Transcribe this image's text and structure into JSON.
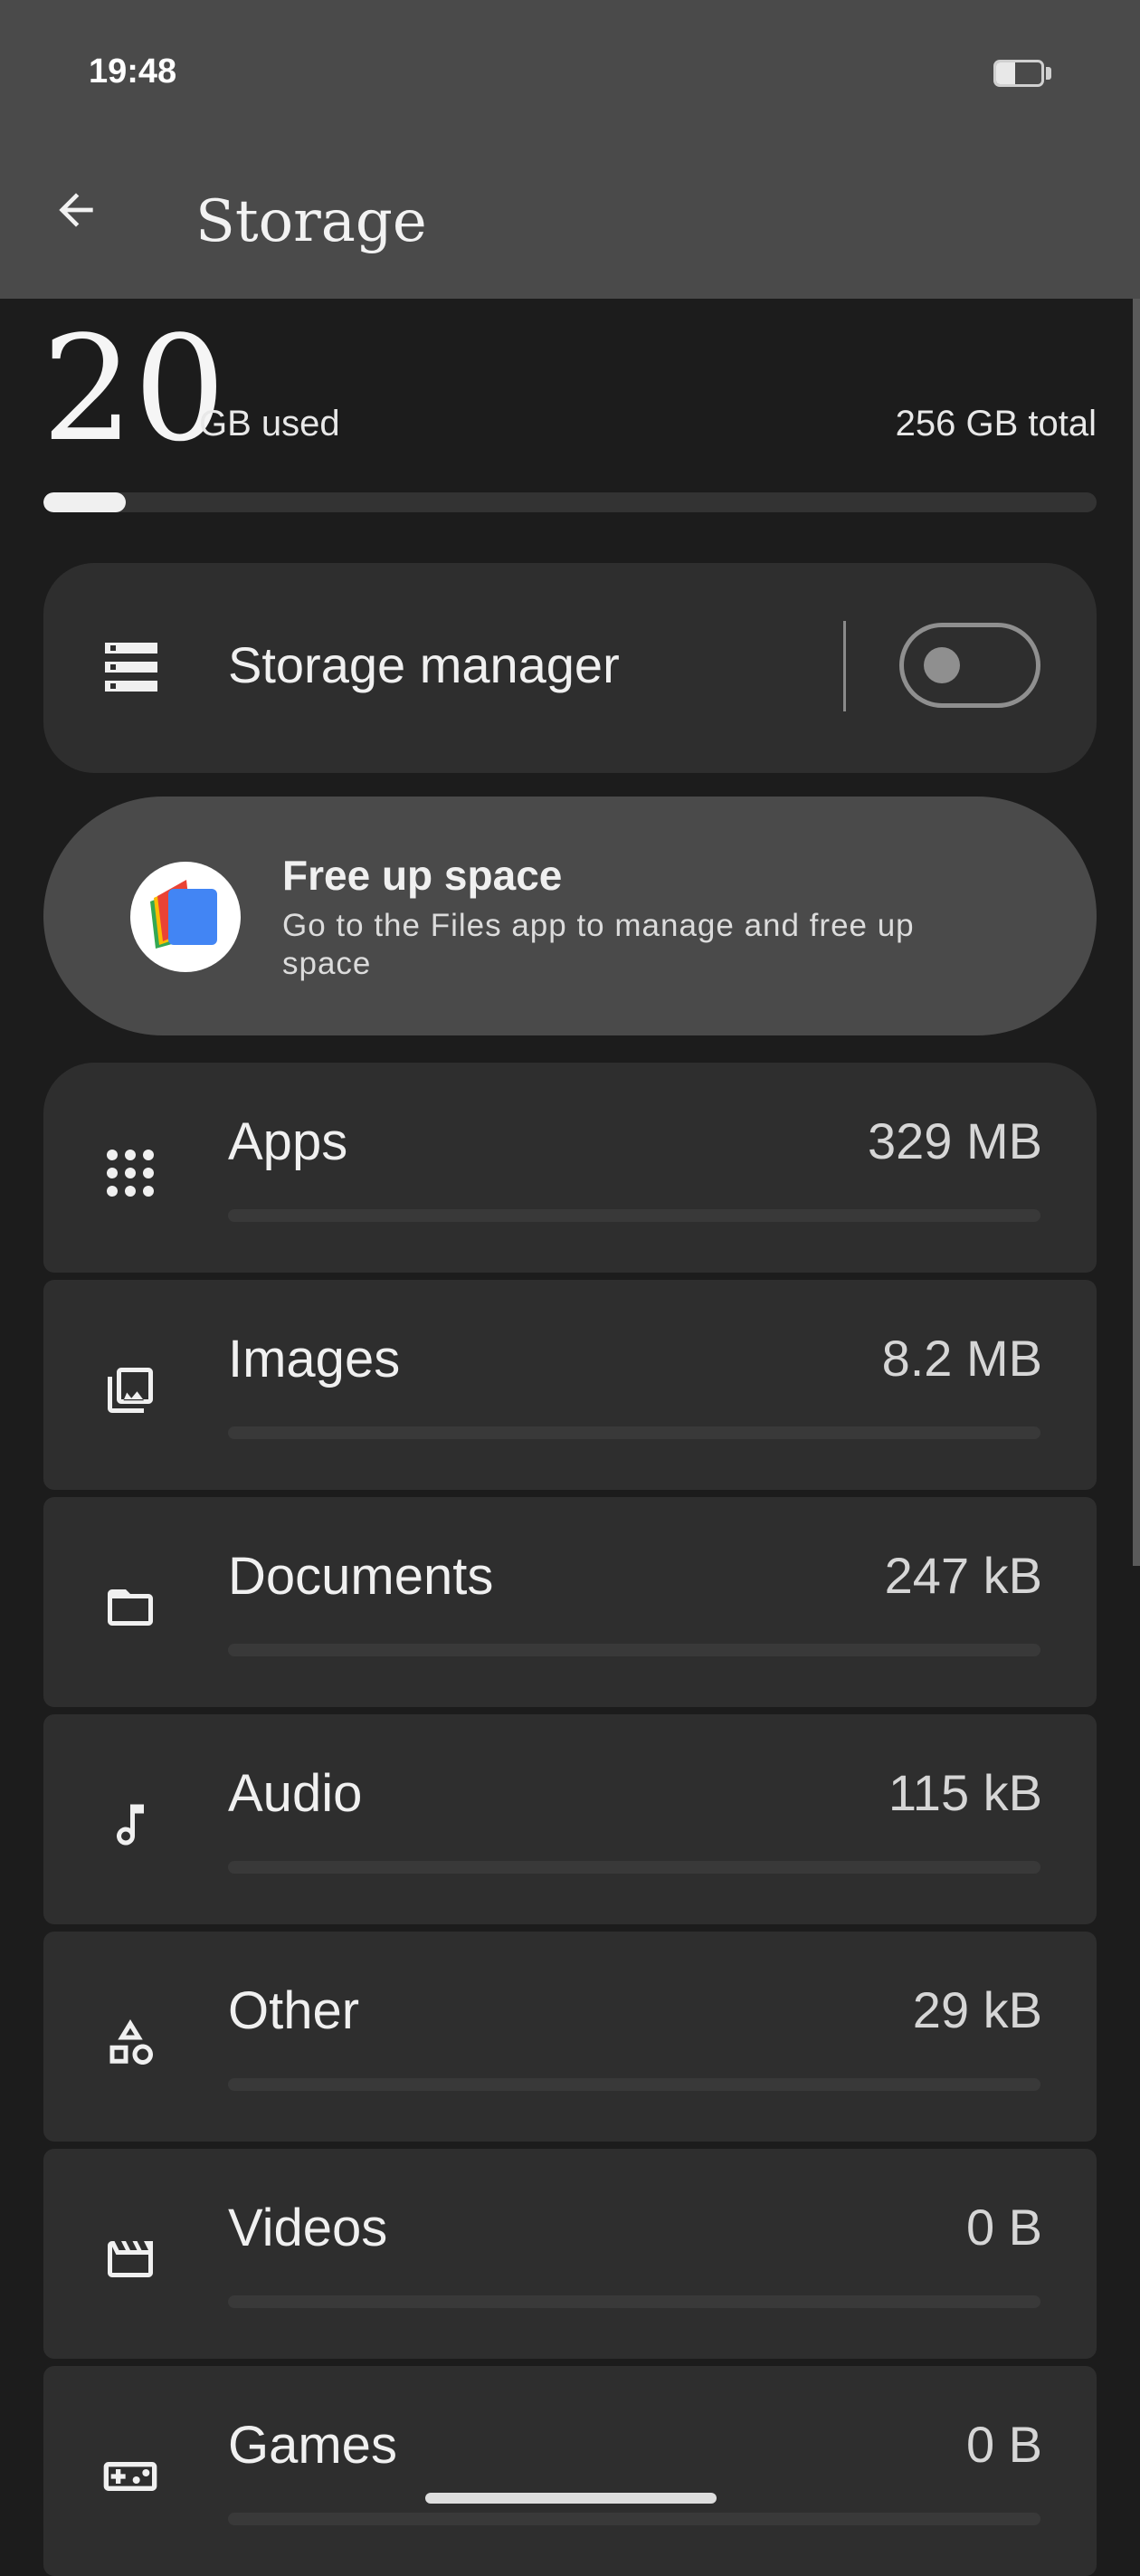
{
  "status_bar": {
    "time": "19:48",
    "battery_level": 0.42
  },
  "app_bar": {
    "title": "Storage",
    "back_icon": "arrow-back-icon"
  },
  "summary": {
    "used_value": "20",
    "used_unit": "GB used",
    "total": "256 GB total",
    "used_fraction": 0.078
  },
  "storage_manager": {
    "label": "Storage manager",
    "enabled": false,
    "icon": "storage-list-icon"
  },
  "free_up": {
    "title": "Free up space",
    "subtitle": "Go to the Files app to manage and free up space",
    "icon": "files-app-logo"
  },
  "categories": [
    {
      "label": "Apps",
      "value": "329 MB",
      "icon": "apps-grid-icon",
      "fraction": 0
    },
    {
      "label": "Images",
      "value": "8.2 MB",
      "icon": "image-icon",
      "fraction": 0
    },
    {
      "label": "Documents",
      "value": "247 kB",
      "icon": "folder-icon",
      "fraction": 0
    },
    {
      "label": "Audio",
      "value": "115 kB",
      "icon": "music-note-icon",
      "fraction": 0
    },
    {
      "label": "Other",
      "value": "29 kB",
      "icon": "shapes-icon",
      "fraction": 0
    },
    {
      "label": "Videos",
      "value": "0 B",
      "icon": "movie-icon",
      "fraction": 0
    },
    {
      "label": "Games",
      "value": "0 B",
      "icon": "gamepad-icon",
      "fraction": 0
    }
  ],
  "colors": {
    "background": "#1c1c1c",
    "header": "#4a4a4a",
    "card": "#2e2e2e",
    "accent": "#f0f0f0"
  }
}
